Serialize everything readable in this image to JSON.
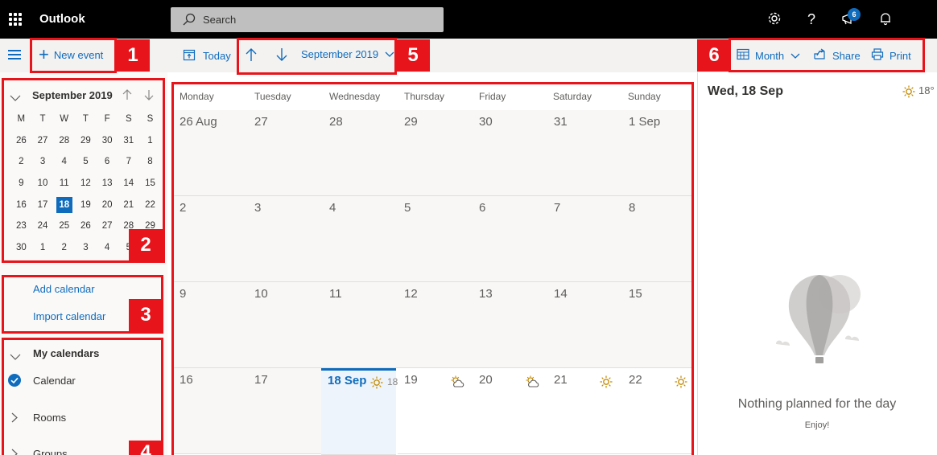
{
  "app": {
    "title": "Outlook"
  },
  "search": {
    "placeholder": "Search"
  },
  "topbar": {
    "notification_count": "6"
  },
  "toolbar": {
    "new_event": "New event",
    "today": "Today",
    "month_nav": "September 2019",
    "view": "Month",
    "share": "Share",
    "print": "Print"
  },
  "mini_calendar": {
    "title": "September 2019",
    "weekdays": [
      "M",
      "T",
      "W",
      "T",
      "F",
      "S",
      "S"
    ],
    "weeks": [
      [
        "26",
        "27",
        "28",
        "29",
        "30",
        "31",
        "1"
      ],
      [
        "2",
        "3",
        "4",
        "5",
        "6",
        "7",
        "8"
      ],
      [
        "9",
        "10",
        "11",
        "12",
        "13",
        "14",
        "15"
      ],
      [
        "16",
        "17",
        "18",
        "19",
        "20",
        "21",
        "22"
      ],
      [
        "23",
        "24",
        "25",
        "26",
        "27",
        "28",
        "29"
      ],
      [
        "30",
        "1",
        "2",
        "3",
        "4",
        "5",
        "6"
      ]
    ],
    "selected": "18"
  },
  "calendar_actions": {
    "add": "Add calendar",
    "import": "Import calendar"
  },
  "my_calendars": {
    "header": "My calendars",
    "items": [
      "Calendar",
      "Rooms",
      "Groups"
    ]
  },
  "month_view": {
    "weekdays": [
      "Monday",
      "Tuesday",
      "Wednesday",
      "Thursday",
      "Friday",
      "Saturday",
      "Sunday"
    ],
    "weeks": [
      [
        "26 Aug",
        "27",
        "28",
        "29",
        "30",
        "31",
        "1 Sep"
      ],
      [
        "2",
        "3",
        "4",
        "5",
        "6",
        "7",
        "8"
      ],
      [
        "9",
        "10",
        "11",
        "12",
        "13",
        "14",
        "15"
      ],
      [
        "16",
        "17",
        "18 Sep",
        "19",
        "20",
        "21",
        "22"
      ]
    ],
    "today_temp": "18",
    "weather": [
      {
        "day": "18 Sep",
        "icon": "sun-icon"
      },
      {
        "day": "19",
        "icon": "partly-cloudy-icon"
      },
      {
        "day": "20",
        "icon": "partly-cloudy-icon"
      },
      {
        "day": "21",
        "icon": "sun-icon"
      },
      {
        "day": "22",
        "icon": "sun-icon"
      }
    ]
  },
  "day_pane": {
    "date": "Wed, 18 Sep",
    "temperature": "18°",
    "empty_title": "Nothing planned for the day",
    "empty_sub": "Enjoy!"
  },
  "annotations": [
    "1",
    "2",
    "3",
    "4",
    "5",
    "6"
  ],
  "colors": {
    "accent": "#0f6cbd",
    "annotation": "#e8141b",
    "topbar": "#000000"
  }
}
